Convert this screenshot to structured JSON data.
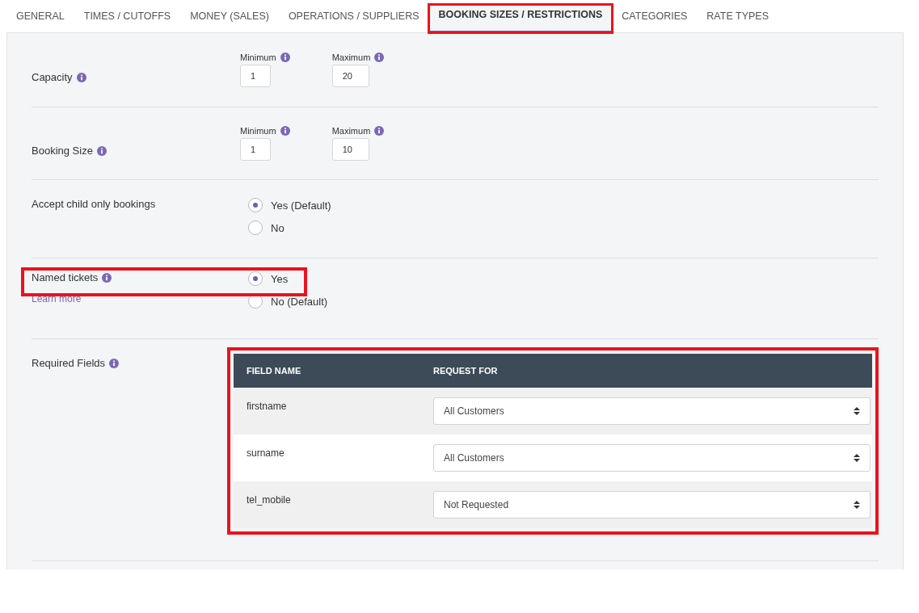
{
  "tabs": [
    {
      "label": "GENERAL",
      "selected": false,
      "highlighted": false
    },
    {
      "label": "TIMES / CUTOFFS",
      "selected": false,
      "highlighted": false
    },
    {
      "label": "MONEY (SALES)",
      "selected": false,
      "highlighted": false
    },
    {
      "label": "OPERATIONS / SUPPLIERS",
      "selected": false,
      "highlighted": false
    },
    {
      "label": "BOOKING SIZES / RESTRICTIONS",
      "selected": true,
      "highlighted": true
    },
    {
      "label": "CATEGORIES",
      "selected": false,
      "highlighted": false
    },
    {
      "label": "RATE TYPES",
      "selected": false,
      "highlighted": false
    }
  ],
  "sections": [
    {
      "kind": "range",
      "label": "Capacity",
      "info": true,
      "highlighted": false,
      "min_label": "Minimum",
      "min_value": "1",
      "max_label": "Maximum",
      "max_value": "20"
    },
    {
      "kind": "range",
      "label": "Booking Size",
      "info": true,
      "highlighted": false,
      "min_label": "Minimum",
      "min_value": "1",
      "max_label": "Maximum",
      "max_value": "10"
    },
    {
      "kind": "radio",
      "label": "Accept child only bookings",
      "info": false,
      "highlighted": false,
      "options": [
        {
          "label": "Yes (Default)",
          "selected": true
        },
        {
          "label": "No",
          "selected": false
        }
      ]
    },
    {
      "kind": "radio",
      "label": "Named tickets",
      "info": true,
      "link": "Learn more",
      "highlighted": true,
      "options": [
        {
          "label": "Yes",
          "selected": true
        },
        {
          "label": "No (Default)",
          "selected": false
        }
      ]
    },
    {
      "kind": "table",
      "label": "Required Fields",
      "info": true,
      "highlighted": true,
      "columns": [
        "FIELD NAME",
        "REQUEST FOR"
      ],
      "rows": [
        {
          "field": "firstname",
          "request_for": "All Customers"
        },
        {
          "field": "surname",
          "request_for": "All Customers"
        },
        {
          "field": "tel_mobile",
          "request_for": "Not Requested"
        }
      ]
    }
  ]
}
